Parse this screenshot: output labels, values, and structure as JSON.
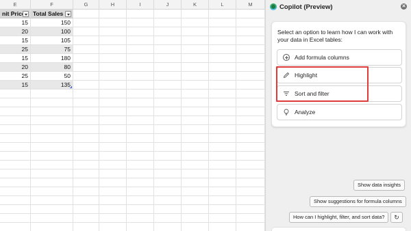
{
  "spreadsheet": {
    "columns": [
      "E",
      "F",
      "G",
      "H",
      "I",
      "J",
      "K",
      "L",
      "M"
    ],
    "header": {
      "unit_price": "nit Price",
      "total_sales": "Total Sales"
    },
    "rows": [
      {
        "unit_price": "15",
        "total_sales": "150"
      },
      {
        "unit_price": "20",
        "total_sales": "100"
      },
      {
        "unit_price": "15",
        "total_sales": "105"
      },
      {
        "unit_price": "25",
        "total_sales": "75"
      },
      {
        "unit_price": "15",
        "total_sales": "180"
      },
      {
        "unit_price": "20",
        "total_sales": "80"
      },
      {
        "unit_price": "25",
        "total_sales": "50"
      },
      {
        "unit_price": "15",
        "total_sales": "135"
      }
    ]
  },
  "copilot": {
    "title": "Copilot (Preview)",
    "close_icon": "close-icon",
    "intro": "Select an option to learn how I can work with your data in Excel tables:",
    "options": [
      {
        "label": "Add formula columns",
        "icon": "plus-circle-icon"
      },
      {
        "label": "Highlight",
        "icon": "pen-icon"
      },
      {
        "label": "Sort and filter",
        "icon": "filter-lines-icon"
      },
      {
        "label": "Analyze",
        "icon": "lightbulb-icon"
      }
    ],
    "suggestions": [
      "Show data insights",
      "Show suggestions for formula columns",
      "How can I highlight, filter, and sort data?"
    ],
    "refresh_icon": "refresh-icon",
    "highlight_color": "#e03b3b"
  }
}
